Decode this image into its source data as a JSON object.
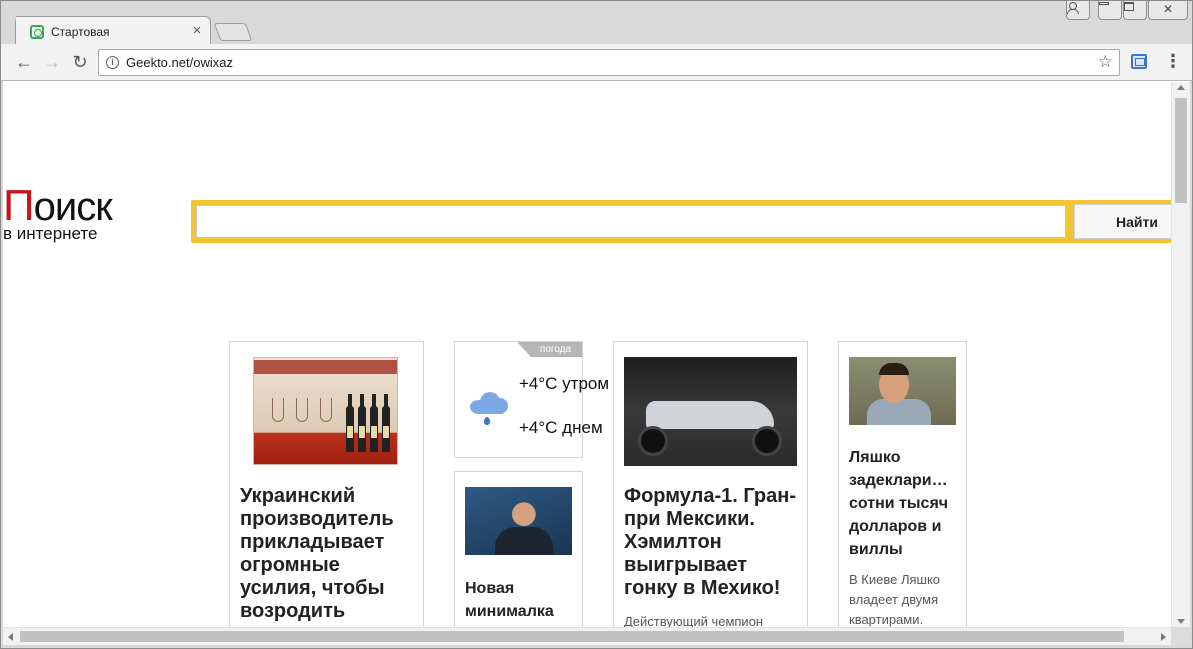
{
  "browser": {
    "tab_title": "Стартовая",
    "tab_close": "×",
    "url": "Geekto.net/owixaz",
    "info_glyph": "i",
    "star_glyph": "☆",
    "menu_glyph": "⋮",
    "close_glyph": "✕",
    "back_glyph": "←",
    "forward_glyph": "→",
    "reload_glyph": "↻"
  },
  "logo": {
    "first_letter": "П",
    "rest": "оиск",
    "subtitle": "в интернете",
    "accent_color": "#c8141e"
  },
  "search": {
    "input_value": "",
    "button_label": "Найти",
    "frame_color": "#f0c531"
  },
  "cards": {
    "wine": {
      "title": "Украинский производитель прикладывает огромные усилия, чтобы возродить"
    },
    "weather": {
      "tag": "погода",
      "morning": "+4°С утром",
      "day": "+4°С днем",
      "icon": "cloud-rain-icon"
    },
    "minimalka": {
      "title": "Новая минималка"
    },
    "formula": {
      "title": "Формула-1. Гран-при Мексики. Хэмилтон выигрывает гонку в Мехико!",
      "desc": "Действующий чемпион"
    },
    "lyashko": {
      "title": "Ляшко задеклари… сотни тысяч долларов и виллы",
      "desc": "В Киеве Ляшко владеет двумя квартирами."
    }
  }
}
